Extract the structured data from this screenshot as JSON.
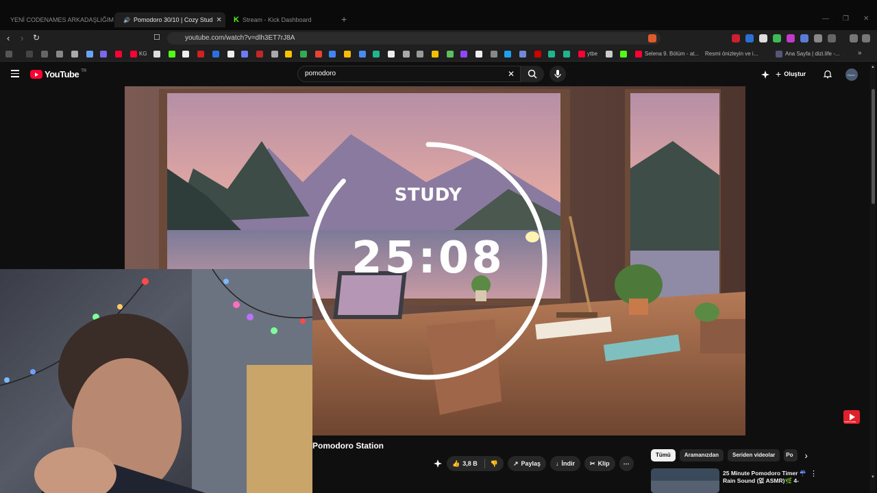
{
  "browser": {
    "tabs": [
      {
        "title": "YENİ CODENAMES ARKADAŞLIĞIMIZ",
        "active": false,
        "icon": "youtube-icon"
      },
      {
        "title": "Pomodoro 30/10 | Cozy Stud",
        "active": true,
        "icon": "youtube-icon"
      },
      {
        "title": "Stream - Kick Dashboard",
        "active": false,
        "icon": "kick-icon"
      }
    ],
    "close_glyph": "✕",
    "new_tab_glyph": "+",
    "url": "youtube.com/watch?v=dlh3ET7rJ8A",
    "bookmarks": [
      {
        "label": "KG"
      },
      {
        "label": "ytbe"
      },
      {
        "label": "Selena 9. Bölüm - at..."
      },
      {
        "label": "Resmi önizleyin ve i..."
      },
      {
        "label": "Ana Sayfa | dizi.life -..."
      }
    ],
    "bookmarks_more": "»"
  },
  "youtube": {
    "logo_text": "YouTube",
    "region": "TR",
    "search_value": "pomodoro",
    "clear_glyph": "✕",
    "create_label": "Oluştur",
    "create_glyph": "+",
    "avatar_text": "Doom"
  },
  "player": {
    "mode_label": "STUDY",
    "time": "25:08",
    "progress": 0.87,
    "brand_text": "SUBSCRIBE"
  },
  "video": {
    "title": "Pomodoro Station",
    "likes": "3,8 B",
    "share_label": "Paylaş",
    "download_label": "İndir",
    "clip_label": "Klip",
    "more_glyph": "⋯"
  },
  "sidebar": {
    "chips": [
      "Tümü",
      "Aramanızdan",
      "Seriden videolar",
      "Po"
    ],
    "next_glyph": "›",
    "rec_title": "25 Minute Pomodoro Timer ☔ Rain Sound (없 ASMR)🌿 4-",
    "rec_more": "⋮"
  },
  "colors": {
    "yt_red": "#ff0033",
    "kick_green": "#53fc18",
    "background": "#0f0f0f"
  }
}
